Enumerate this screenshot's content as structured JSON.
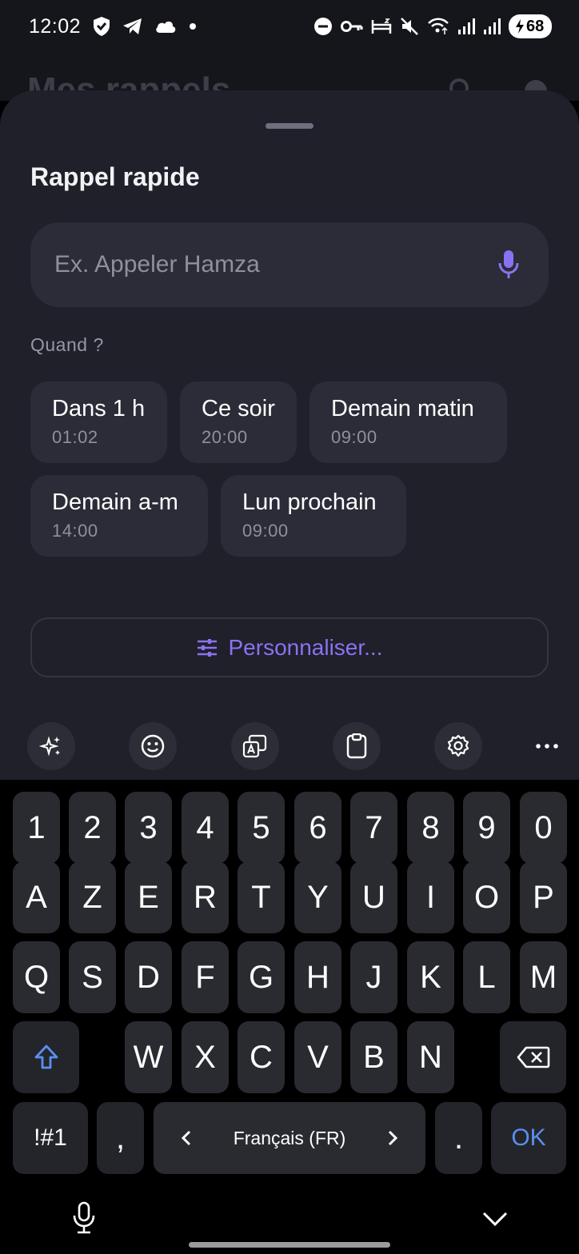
{
  "status_bar": {
    "time": "12:02",
    "battery": "68",
    "icons_left": [
      "shield-icon",
      "telegram-icon",
      "cloud-icon",
      "dot-icon"
    ],
    "icons_right": [
      "dnd-icon",
      "key-icon",
      "bed-icon",
      "mute-icon",
      "wifi-icon",
      "signal-icon",
      "signal-icon",
      "battery-icon"
    ]
  },
  "background_app": {
    "title": "Mes rappels"
  },
  "sheet": {
    "title": "Rappel rapide",
    "input": {
      "placeholder": "Ex. Appeler Hamza",
      "value": ""
    },
    "when_label": "Quand ?",
    "chips": [
      {
        "label": "Dans 1 h",
        "time": "01:02"
      },
      {
        "label": "Ce soir",
        "time": "20:00"
      },
      {
        "label": "Demain matin",
        "time": "09:00"
      },
      {
        "label": "Demain a-m",
        "time": "14:00"
      },
      {
        "label": "Lun prochain",
        "time": "09:00"
      }
    ],
    "customize_label": "Personnaliser..."
  },
  "keyboard": {
    "toolbar": [
      "ai-sparkle-icon",
      "emoji-icon",
      "translate-icon",
      "clipboard-icon",
      "settings-icon",
      "more-icon"
    ],
    "rows": {
      "numbers": [
        "1",
        "2",
        "3",
        "4",
        "5",
        "6",
        "7",
        "8",
        "9",
        "0"
      ],
      "row1": [
        "A",
        "Z",
        "E",
        "R",
        "T",
        "Y",
        "U",
        "I",
        "O",
        "P"
      ],
      "row2": [
        "Q",
        "S",
        "D",
        "F",
        "G",
        "H",
        "J",
        "K",
        "L",
        "M"
      ],
      "row3": [
        "W",
        "X",
        "C",
        "V",
        "B",
        "N"
      ]
    },
    "symbols_key": "!#1",
    "comma_key": ",",
    "space_label": "Français (FR)",
    "period_key": ".",
    "ok_key": "OK"
  },
  "colors": {
    "accent": "#8a72f2",
    "ok_blue": "#5b8ff0",
    "sheet_bg": "#1f2029",
    "chip_bg": "#2b2c37"
  }
}
